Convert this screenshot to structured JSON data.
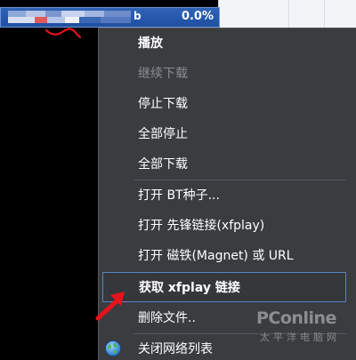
{
  "task": {
    "name_suffix": "b",
    "progress": "0.0%"
  },
  "context_menu": {
    "items": [
      {
        "label": "播放",
        "state": "bold"
      },
      {
        "label": "继续下载",
        "state": "disabled"
      },
      {
        "label": "停止下载",
        "state": "normal"
      },
      {
        "label": "全部停止",
        "state": "normal"
      },
      {
        "label": "全部下载",
        "state": "normal"
      },
      {
        "label": "打开 BT种子...",
        "state": "normal"
      },
      {
        "label": "打开 先锋链接(xfplay)",
        "state": "normal"
      },
      {
        "label": "打开 磁铁(Magnet) 或 URL",
        "state": "normal"
      },
      {
        "label": "获取 xfplay 链接",
        "state": "highlighted"
      },
      {
        "label": "删除文件..",
        "state": "normal"
      },
      {
        "label": "关闭网络列表",
        "state": "normal",
        "icon": "globe-icon"
      }
    ]
  },
  "watermark": {
    "brand": "PConline",
    "subtitle": "太平洋电脑网"
  },
  "colors": {
    "selection": "#2f63b8",
    "menu_bg": "#3a3c40",
    "highlight_border": "#5b84c4",
    "annotation": "#e8121b"
  }
}
